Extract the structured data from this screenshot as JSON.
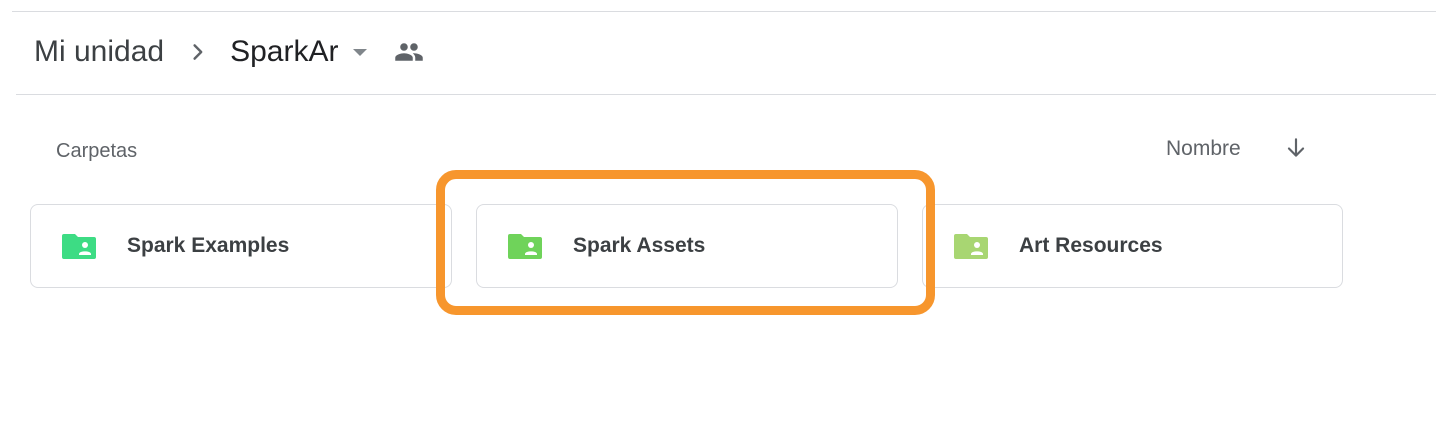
{
  "breadcrumb": {
    "root": "Mi unidad",
    "current": "SparkAr"
  },
  "icons": {
    "separator": "chevron-right-icon",
    "dropdown": "caret-down-icon",
    "shared": "people-icon",
    "sort": "arrow-down-icon",
    "folder": "shared-folder-icon"
  },
  "folders_section": {
    "label": "Carpetas",
    "sort_label": "Nombre",
    "items": [
      {
        "name": "Spark Examples",
        "color": "#3ddc84"
      },
      {
        "name": "Spark Assets",
        "color": "#6fd35a"
      },
      {
        "name": "Art Resources",
        "color": "#a8d672"
      }
    ]
  },
  "colors": {
    "highlight": "#f7962d",
    "divider": "#dadce0",
    "text_primary": "#202124",
    "text_secondary": "#5f6368"
  }
}
